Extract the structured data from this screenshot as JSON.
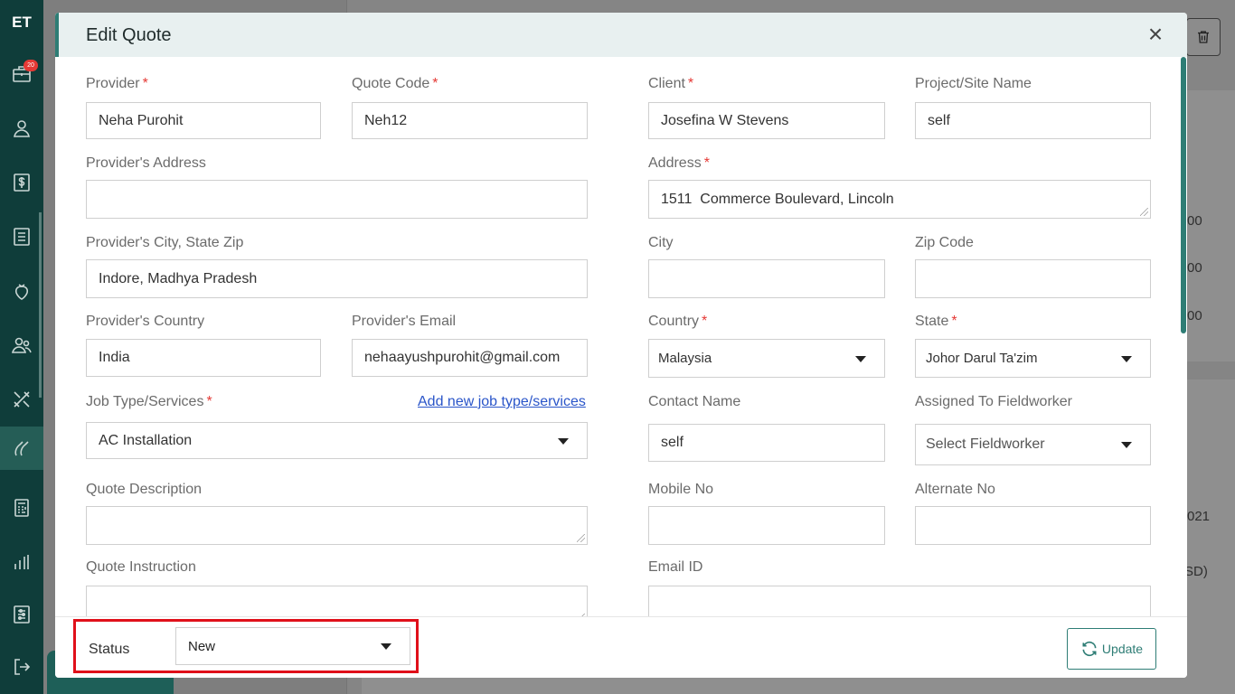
{
  "sidebar": {
    "logo": "ET",
    "badge": "20",
    "items": [
      "briefcase-icon",
      "user-icon",
      "dollar-icon",
      "list-icon",
      "strawberry-icon",
      "users-icon",
      "tools-icon",
      "fuel-icon",
      "calculator-icon",
      "chart-icon",
      "sliders-icon",
      "logout-icon"
    ]
  },
  "background": {
    "values": [
      "00",
      "00",
      "00",
      "021",
      "SD)"
    ]
  },
  "modal": {
    "title": "Edit Quote",
    "close": "×",
    "fields": {
      "provider": {
        "label": "Provider",
        "value": "Neha Purohit"
      },
      "quote_code": {
        "label": "Quote Code",
        "value": "Neh12"
      },
      "client": {
        "label": "Client",
        "value": "Josefina W Stevens"
      },
      "project_site": {
        "label": "Project/Site Name",
        "value": "self"
      },
      "provider_address": {
        "label": "Provider's Address",
        "value": ""
      },
      "address": {
        "label": "Address",
        "value": "1511  Commerce Boulevard, Lincoln"
      },
      "provider_city": {
        "label": "Provider's City, State Zip",
        "value": "Indore, Madhya Pradesh"
      },
      "city": {
        "label": "City",
        "value": ""
      },
      "zip_code": {
        "label": "Zip Code",
        "value": ""
      },
      "provider_country": {
        "label": "Provider's Country",
        "value": "India"
      },
      "provider_email": {
        "label": "Provider's Email",
        "value": "nehaayushpurohit@gmail.com"
      },
      "country": {
        "label": "Country",
        "value": "Malaysia"
      },
      "state": {
        "label": "State",
        "value": "Johor Darul Ta'zim"
      },
      "job_type": {
        "label": "Job Type/Services",
        "value": "AC Installation",
        "link": "Add new job type/services"
      },
      "contact_name": {
        "label": "Contact Name",
        "value": "self"
      },
      "assigned_to": {
        "label": "Assigned To Fieldworker",
        "value": "Select Fieldworker"
      },
      "quote_description": {
        "label": "Quote Description",
        "value": ""
      },
      "mobile_no": {
        "label": "Mobile No",
        "value": ""
      },
      "alternate_no": {
        "label": "Alternate No",
        "value": ""
      },
      "quote_instruction": {
        "label": "Quote Instruction",
        "value": ""
      },
      "email_id": {
        "label": "Email ID",
        "value": ""
      }
    },
    "required_mark": "*",
    "footer": {
      "status_label": "Status",
      "status_value": "New",
      "update_label": "Update"
    }
  },
  "colors": {
    "accent": "#2e7d75",
    "sidebar": "#0f3d3a",
    "required": "#e53935",
    "highlight": "#e0101a",
    "link": "#2a55c9"
  }
}
